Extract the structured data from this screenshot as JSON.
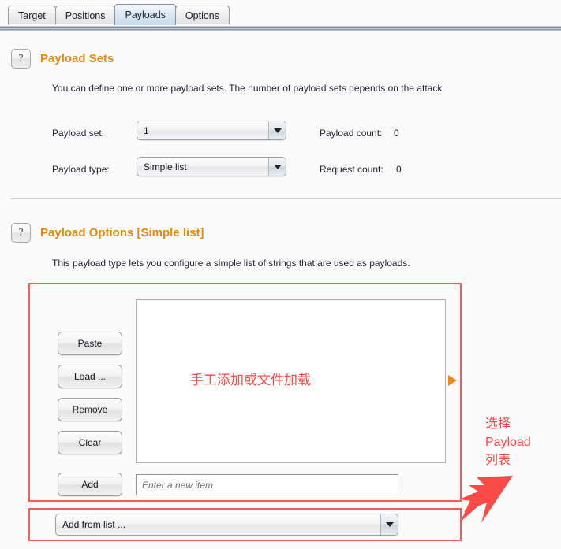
{
  "window": {
    "tabs": [
      {
        "label": "Target",
        "active": false
      },
      {
        "label": "Positions",
        "active": false
      },
      {
        "label": "Payloads",
        "active": true
      },
      {
        "label": "Options",
        "active": false
      }
    ]
  },
  "payload_sets": {
    "help_icon": "question-mark-icon",
    "title": "Payload Sets",
    "description": "You can define one or more payload sets. The number of payload sets depends on the attack",
    "payload_set_label": "Payload set:",
    "payload_set_value": "1",
    "payload_type_label": "Payload type:",
    "payload_type_value": "Simple list",
    "payload_count_label": "Payload count:",
    "payload_count_value": "0",
    "request_count_label": "Request count:",
    "request_count_value": "0"
  },
  "payload_options": {
    "help_icon": "question-mark-icon",
    "title": "Payload Options [Simple list]",
    "description": "This payload type lets you configure a simple list of strings that are used as payloads.",
    "buttons": [
      {
        "label": "Paste"
      },
      {
        "label": "Load ..."
      },
      {
        "label": "Remove"
      },
      {
        "label": "Clear"
      }
    ],
    "add_button": "Add",
    "new_item_placeholder": "Enter a new item",
    "add_from_list_value": "Add from list ...",
    "list_items": []
  },
  "annotations": {
    "center_note": "手工添加或文件加载",
    "right_note_lines": [
      "选择",
      "Payload",
      "列表"
    ],
    "marker_icon": "orange-right-triangle-icon",
    "arrow_icon": "red-arrow-icon",
    "color": "#fb4a46"
  },
  "colors": {
    "accent_orange": "#e8890c",
    "annotation_red": "#fb4a46",
    "marker_orange": "#f08a12",
    "background": "#fbfbfb"
  }
}
